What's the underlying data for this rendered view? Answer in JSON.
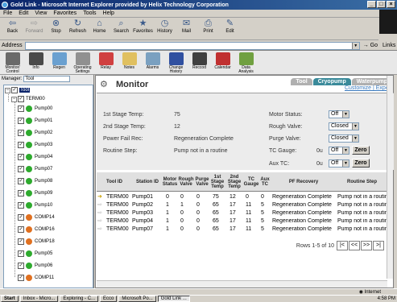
{
  "window": {
    "title": "Gold Link - Microsoft Internet Explorer provided by Helix Technology Corporation",
    "min": "_",
    "max": "□",
    "close": "×"
  },
  "menu": [
    "File",
    "Edit",
    "View",
    "Favorites",
    "Tools",
    "Help"
  ],
  "ie_toolbar": [
    {
      "label": "Back",
      "icon": "back-arrow-icon",
      "disabled": false
    },
    {
      "label": "Forward",
      "icon": "forward-arrow-icon",
      "disabled": true
    },
    {
      "label": "Stop",
      "icon": "stop-icon",
      "disabled": false
    },
    {
      "label": "Refresh",
      "icon": "refresh-icon",
      "disabled": false
    },
    {
      "label": "Home",
      "icon": "home-icon",
      "disabled": false
    },
    {
      "label": "Search",
      "icon": "search-icon",
      "disabled": false
    },
    {
      "label": "Favorites",
      "icon": "favorites-icon",
      "disabled": false
    },
    {
      "label": "History",
      "icon": "history-icon",
      "disabled": false
    },
    {
      "label": "Mail",
      "icon": "mail-icon",
      "disabled": false
    },
    {
      "label": "Print",
      "icon": "print-icon",
      "disabled": false
    },
    {
      "label": "Edit",
      "icon": "edit-icon",
      "disabled": false
    }
  ],
  "address": {
    "label": "Address",
    "value": "",
    "go": "Go",
    "links": "Links"
  },
  "app_toolbar": [
    {
      "label": "Monitor/ Control",
      "color": "#6a6a6a"
    },
    {
      "label": "Info",
      "color": "#4a4a4a"
    },
    {
      "label": "Regen",
      "color": "#6aa0d0"
    },
    {
      "label": "Operating Settings",
      "color": "#909090"
    },
    {
      "label": "Relay",
      "color": "#d04040"
    },
    {
      "label": "Notes",
      "color": "#e0c060"
    },
    {
      "label": "Alarms",
      "color": "#7aa0c0"
    },
    {
      "label": "Change History",
      "color": "#3050a0"
    },
    {
      "label": "Reccod",
      "color": "#404040"
    },
    {
      "label": "Calendar",
      "color": "#c03030"
    },
    {
      "label": "Data Analysis",
      "color": "#70a040"
    }
  ],
  "manager": {
    "label": "Manager",
    "value": "Tool"
  },
  "tree": {
    "root": "Tool",
    "group": "TERM00",
    "items": [
      {
        "label": "Pump00",
        "status": "green"
      },
      {
        "label": "Pump01",
        "status": "green"
      },
      {
        "label": "Pump02",
        "status": "green"
      },
      {
        "label": "Pump03",
        "status": "green"
      },
      {
        "label": "Pump04",
        "status": "green"
      },
      {
        "label": "Pump07",
        "status": "green"
      },
      {
        "label": "Pump08",
        "status": "green"
      },
      {
        "label": "Pump09",
        "status": "green"
      },
      {
        "label": "Pump10",
        "status": "green"
      },
      {
        "label": "COMP14",
        "status": "orange"
      },
      {
        "label": "COMP16",
        "status": "orange"
      },
      {
        "label": "COMP18",
        "status": "orange"
      },
      {
        "label": "Pump05",
        "status": "green"
      },
      {
        "label": "Pump06",
        "status": "green"
      },
      {
        "label": "COMP11",
        "status": "orange"
      }
    ]
  },
  "monitor": {
    "title": "Monitor",
    "tabs": [
      "Tool",
      "Cryopump",
      "Waterpump"
    ],
    "links": "Customize | Export",
    "fields_left": [
      {
        "label": "1st Stage Temp:",
        "value": "75"
      },
      {
        "label": "2nd Stage Temp:",
        "value": "12"
      },
      {
        "label": "Power Fail Rec:",
        "value": "Regeneration Complete"
      },
      {
        "label": "Routine Step:",
        "value": "Pump not in a routine"
      }
    ],
    "fields_right": [
      {
        "label": "Motor Status:",
        "value": "Off"
      },
      {
        "label": "Rough Valve:",
        "value": "Closed"
      },
      {
        "label": "Purge Valve:",
        "value": "Closed"
      },
      {
        "label": "TC Gauge:",
        "reading": "0u",
        "value": "Off",
        "button": "Zero"
      },
      {
        "label": "Aux TC:",
        "reading": "0u",
        "value": "Off",
        "button": "Zero"
      }
    ]
  },
  "table": {
    "headers": [
      "Tool ID",
      "Station ID",
      "Motor Status",
      "Rough Valve",
      "Purge Valve",
      "1st Stage Temp",
      "2nd Stage Temp",
      "TC Gauge",
      "Aux TC",
      "PF Recovery",
      "Routine Step"
    ],
    "rows": [
      [
        "TERM00",
        "Pump01",
        "0",
        "0",
        "0",
        "75",
        "12",
        "0",
        "0",
        "Regeneration Complete",
        "Pump not in a routine"
      ],
      [
        "TERM00",
        "Pump02",
        "1",
        "1",
        "0",
        "65",
        "17",
        "11",
        "5",
        "Regeneration Complete",
        "Pump not in a routine"
      ],
      [
        "TERM00",
        "Pump03",
        "1",
        "0",
        "0",
        "65",
        "17",
        "11",
        "5",
        "Regeneration Complete",
        "Pump not in a routine"
      ],
      [
        "TERM00",
        "Pump04",
        "1",
        "0",
        "0",
        "65",
        "17",
        "11",
        "5",
        "Regeneration Complete",
        "Pump not in a routine"
      ],
      [
        "TERM00",
        "Pump07",
        "1",
        "0",
        "0",
        "65",
        "17",
        "11",
        "5",
        "Regeneration Complete",
        "Pump not in a routine"
      ]
    ],
    "pager_text": "Rows 1-5 of 10",
    "pager_buttons": [
      "|<",
      "<<",
      ">>",
      ">|"
    ]
  },
  "status": {
    "left": "",
    "zone": "Internet"
  },
  "taskbar": {
    "start": "Start",
    "tasks": [
      "Inbox - Micro...",
      "Exploring - C...",
      "Ecco",
      "Microsoft Po...",
      "Gold Link ..."
    ],
    "clock": "4:58 PM"
  }
}
